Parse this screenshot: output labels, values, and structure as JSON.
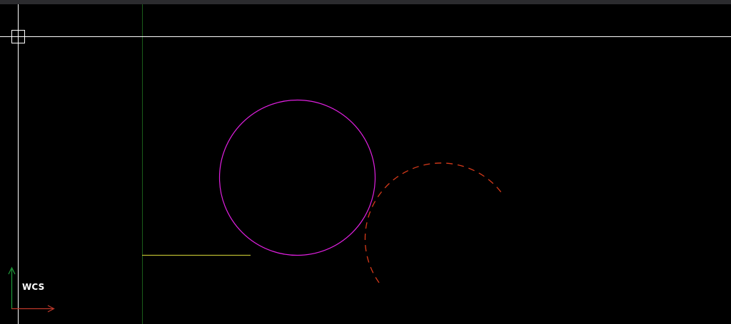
{
  "app": {
    "background_color": "#000000",
    "top_strip_color": "#2b2b2e"
  },
  "cursor": {
    "type": "crosshair-pickbox",
    "color": "#ffffff"
  },
  "ucs": {
    "label": "WCS",
    "x_axis_color": "#c0392b",
    "y_axis_color": "#1f9a3a"
  },
  "entities": [
    {
      "type": "line",
      "name": "green-vertical-line",
      "color": "#1a5c1a"
    },
    {
      "type": "line",
      "name": "yellow-horizontal-line",
      "color": "#b9b92f"
    },
    {
      "type": "circle",
      "name": "magenta-circle",
      "color": "#e020e0"
    },
    {
      "type": "arc",
      "name": "red-dashed-arc",
      "color": "#d83a1a",
      "linetype": "dashed"
    }
  ]
}
